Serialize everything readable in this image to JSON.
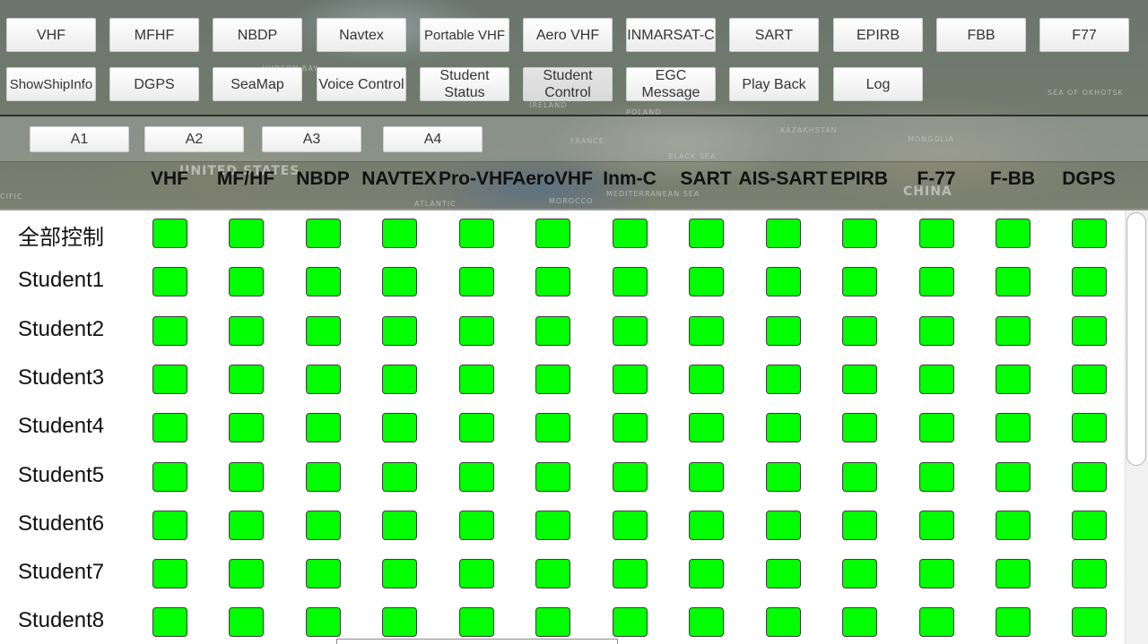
{
  "map_labels": [
    "UNITED STATES",
    "Hudson Bay",
    "Sea of Okhotsk",
    "KAZAKHSTAN",
    "MONGOLIA",
    "CHINA",
    "Atlantic",
    "cific",
    "IRELAND",
    "POLAND",
    "FRANCE",
    "Black Sea",
    "Mediterranean Sea",
    "MOROCCO"
  ],
  "toolbar_row1": [
    "VHF",
    "MFHF",
    "NBDP",
    "Navtex",
    "Portable VHF",
    "Aero VHF",
    "INMARSAT-C",
    "SART",
    "EPIRB",
    "FBB",
    "F77"
  ],
  "toolbar_row2": [
    "ShowShipInfo",
    "DGPS",
    "SeaMap",
    "Voice Control",
    "Student Status",
    "Student Control",
    "EGC Message",
    "Play Back",
    "Log"
  ],
  "area_tabs": [
    "A1",
    "A2",
    "A3",
    "A4"
  ],
  "columns": [
    "VHF",
    "MF/HF",
    "NBDP",
    "NAVTEX",
    "Pro-VHF",
    "AeroVHF",
    "Inm-C",
    "SART",
    "AIS-SART",
    "EPIRB",
    "F-77",
    "F-BB",
    "DGPS"
  ],
  "rows": [
    "全部控制",
    "Student1",
    "Student2",
    "Student3",
    "Student4",
    "Student5",
    "Student6",
    "Student7",
    "Student8"
  ],
  "toggle_state": "enabled",
  "colors": {
    "toggle_on": "#00ff00",
    "toggle_border": "#3d3d3d",
    "panel_bg": "#ffffff"
  }
}
